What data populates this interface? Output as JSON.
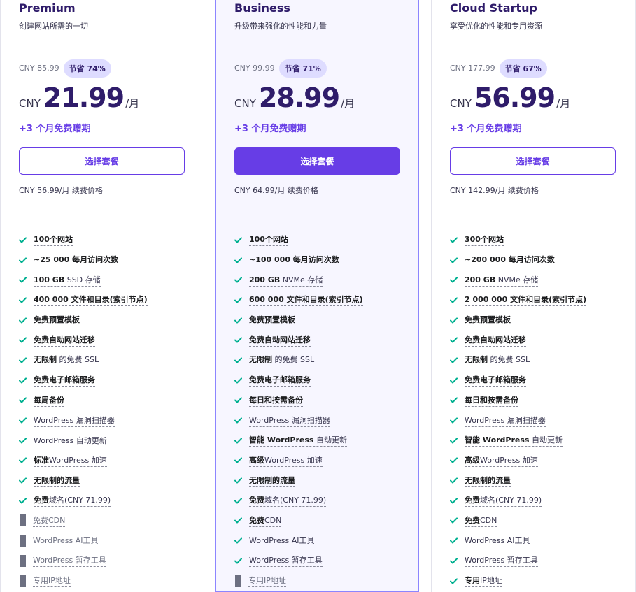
{
  "colors": {
    "accent": "#673de6",
    "check": "#00b090",
    "disabled": "#6d7081",
    "highlight_bg": "#f7f6ff"
  },
  "plans": [
    {
      "name": "Premium",
      "tagline": "创建网站所需的一切",
      "old_price": "CNY 85.99",
      "badge": "节省 74%",
      "currency": "CNY",
      "amount": "21.99",
      "per": "/月",
      "bonus": "+3 个月免费赠期",
      "button": "选择套餐",
      "renew": "CNY 56.99/月 续费价格",
      "features": [
        {
          "icon": "check-icon",
          "style": "bold",
          "text": "100个网站"
        },
        {
          "icon": "check-icon",
          "style": "bold",
          "text": "~25 000 每月访问次数"
        },
        {
          "icon": "check-icon",
          "style": "plain",
          "bold": "100 GB",
          "text": " SSD 存储"
        },
        {
          "icon": "check-icon",
          "style": "bold",
          "text": "400 000 文件和目录(索引节点)"
        },
        {
          "icon": "check-icon",
          "style": "bold",
          "text": "免费预置模板"
        },
        {
          "icon": "check-icon",
          "style": "bold",
          "text": "免费自动网站迁移"
        },
        {
          "icon": "check-icon",
          "style": "plain",
          "bold": "无限制",
          "text": " 的免费 SSL"
        },
        {
          "icon": "check-icon",
          "style": "bold",
          "text": "免费电子邮箱服务"
        },
        {
          "icon": "check-icon",
          "style": "bold",
          "text": "每周备份"
        },
        {
          "icon": "check-icon",
          "style": "plain",
          "text": "WordPress 漏洞扫描器"
        },
        {
          "icon": "check-icon",
          "style": "plainnoline",
          "text": "WordPress 自动更新"
        },
        {
          "icon": "check-icon",
          "style": "plain",
          "bold": "标准",
          "text": "WordPress 加速"
        },
        {
          "icon": "check-icon",
          "style": "bold",
          "text": "无限制的流量"
        },
        {
          "icon": "check-icon",
          "style": "plain",
          "bold": "免费",
          "text": "域名(CNY 71.99)"
        },
        {
          "icon": "cross-icon",
          "style": "grey",
          "text": "免费CDN"
        },
        {
          "icon": "cross-icon",
          "style": "grey",
          "text": "WordPress AI工具"
        },
        {
          "icon": "cross-icon",
          "style": "grey",
          "text": "WordPress 暂存工具"
        },
        {
          "icon": "cross-icon",
          "style": "grey",
          "text": "专用IP地址"
        }
      ]
    },
    {
      "name": "Business",
      "tagline": "升级带来强化的性能和力量",
      "old_price": "CNY 99.99",
      "badge": "节省 71%",
      "currency": "CNY",
      "amount": "28.99",
      "per": "/月",
      "bonus": "+3 个月免费赠期",
      "button": "选择套餐",
      "renew": "CNY 64.99/月 续费价格",
      "features": [
        {
          "icon": "check-icon",
          "style": "bold",
          "text": "100个网站"
        },
        {
          "icon": "check-icon",
          "style": "bold",
          "text": "~100 000 每月访问次数"
        },
        {
          "icon": "check-icon",
          "style": "plain",
          "bold": "200 GB",
          "text": " NVMe 存储"
        },
        {
          "icon": "check-icon",
          "style": "bold",
          "text": "600 000 文件和目录(索引节点)"
        },
        {
          "icon": "check-icon",
          "style": "bold",
          "text": "免费预置模板"
        },
        {
          "icon": "check-icon",
          "style": "bold",
          "text": "免费自动网站迁移"
        },
        {
          "icon": "check-icon",
          "style": "plain",
          "bold": "无限制",
          "text": " 的免费 SSL"
        },
        {
          "icon": "check-icon",
          "style": "bold",
          "text": "免费电子邮箱服务"
        },
        {
          "icon": "check-icon",
          "style": "bold",
          "text": "每日和按需备份"
        },
        {
          "icon": "check-icon",
          "style": "plain",
          "text": "WordPress 漏洞扫描器"
        },
        {
          "icon": "check-icon",
          "style": "plain",
          "bold": "智能 WordPress",
          "text": " 自动更新"
        },
        {
          "icon": "check-icon",
          "style": "plain",
          "bold": "高级",
          "text": "WordPress 加速"
        },
        {
          "icon": "check-icon",
          "style": "bold",
          "text": "无限制的流量"
        },
        {
          "icon": "check-icon",
          "style": "plain",
          "bold": "免费",
          "text": "域名(CNY 71.99)"
        },
        {
          "icon": "check-icon",
          "style": "plain",
          "bold": "免费",
          "text": "CDN"
        },
        {
          "icon": "check-icon",
          "style": "plain",
          "text": "WordPress AI工具"
        },
        {
          "icon": "check-icon",
          "style": "plain",
          "text": "WordPress 暂存工具"
        },
        {
          "icon": "cross-icon",
          "style": "grey",
          "text": "专用IP地址"
        }
      ]
    },
    {
      "name": "Cloud Startup",
      "tagline": "享受优化的性能和专用资源",
      "old_price": "CNY 177.99",
      "badge": "节省 67%",
      "currency": "CNY",
      "amount": "56.99",
      "per": "/月",
      "bonus": "+3 个月免费赠期",
      "button": "选择套餐",
      "renew": "CNY 142.99/月 续费价格",
      "features": [
        {
          "icon": "check-icon",
          "style": "bold",
          "text": "300个网站"
        },
        {
          "icon": "check-icon",
          "style": "bold",
          "text": "~200 000 每月访问次数"
        },
        {
          "icon": "check-icon",
          "style": "plain",
          "bold": "200 GB",
          "text": " NVMe 存储"
        },
        {
          "icon": "check-icon",
          "style": "bold",
          "text": "2 000 000 文件和目录(索引节点)"
        },
        {
          "icon": "check-icon",
          "style": "bold",
          "text": "免费预置模板"
        },
        {
          "icon": "check-icon",
          "style": "bold",
          "text": "免费自动网站迁移"
        },
        {
          "icon": "check-icon",
          "style": "plain",
          "bold": "无限制",
          "text": " 的免费 SSL"
        },
        {
          "icon": "check-icon",
          "style": "bold",
          "text": "免费电子邮箱服务"
        },
        {
          "icon": "check-icon",
          "style": "bold",
          "text": "每日和按需备份"
        },
        {
          "icon": "check-icon",
          "style": "plain",
          "text": "WordPress 漏洞扫描器"
        },
        {
          "icon": "check-icon",
          "style": "plain",
          "bold": "智能 WordPress",
          "text": " 自动更新"
        },
        {
          "icon": "check-icon",
          "style": "plain",
          "bold": "高级",
          "text": "WordPress 加速"
        },
        {
          "icon": "check-icon",
          "style": "bold",
          "text": "无限制的流量"
        },
        {
          "icon": "check-icon",
          "style": "plain",
          "bold": "免费",
          "text": "域名(CNY 71.99)"
        },
        {
          "icon": "check-icon",
          "style": "plain",
          "bold": "免费",
          "text": "CDN"
        },
        {
          "icon": "check-icon",
          "style": "plain",
          "text": "WordPress AI工具"
        },
        {
          "icon": "check-icon",
          "style": "plain",
          "text": "WordPress 暂存工具"
        },
        {
          "icon": "check-icon",
          "style": "plain",
          "bold": "专用",
          "text": "IP地址"
        }
      ]
    }
  ]
}
